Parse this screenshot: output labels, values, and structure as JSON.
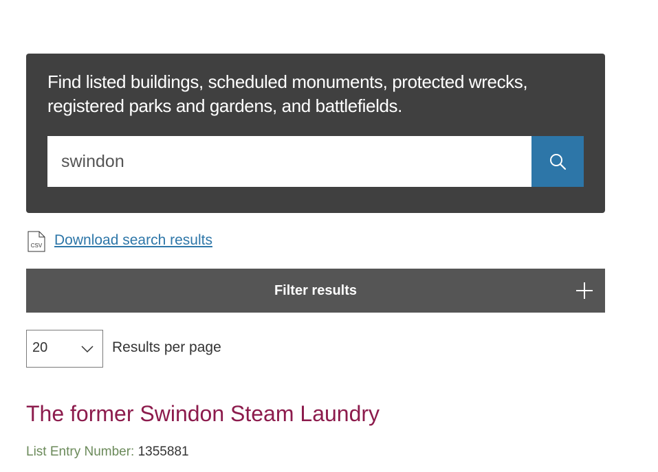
{
  "search": {
    "intro": "Find listed buildings, scheduled monuments, protected wrecks, registered parks and gardens, and battlefields.",
    "query": "swindon",
    "button_icon": "search-icon"
  },
  "download": {
    "icon_label": "CSV",
    "link_label": "Download search results"
  },
  "filter": {
    "label": "Filter results",
    "icon": "plus-icon"
  },
  "pagination": {
    "per_page_value": "20",
    "per_page_label": "Results per page"
  },
  "results": [
    {
      "title": "The former Swindon Steam Laundry",
      "entry_label": "List Entry Number:",
      "entry_number": "1355881"
    }
  ],
  "colors": {
    "panel": "#404040",
    "search_button": "#2d76a8",
    "link": "#2d76a8",
    "filter_bar": "#555555",
    "result_title": "#8c1b4c",
    "entry_label": "#6b8a5a"
  }
}
